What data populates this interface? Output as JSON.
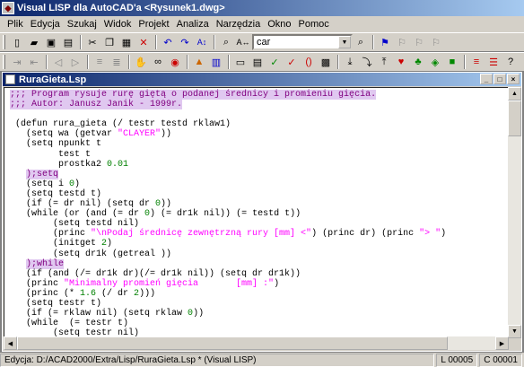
{
  "window": {
    "title": "Visual LISP dla AutoCAD'a <Rysunek1.dwg>"
  },
  "menu": [
    "Plik",
    "Edycja",
    "Szukaj",
    "Widok",
    "Projekt",
    "Analiza",
    "Narzędzia",
    "Okno",
    "Pomoc"
  ],
  "toolbar": {
    "search_value": "car"
  },
  "document": {
    "title": "RuraGieta.Lsp",
    "lines": [
      [
        {
          "t": ";;; Program rysuje rurę giętą o podanej średnicy i promieniu gięcia.",
          "c": "cmt"
        }
      ],
      [
        {
          "t": ";;; Autor: Janusz Janik - 1999r.",
          "c": "cmt"
        }
      ],
      [
        {
          "t": ""
        }
      ],
      [
        {
          "t": " (defun rura_gieta (/ testr testd rklaw1)"
        }
      ],
      [
        {
          "t": "   (setq wa (getvar "
        },
        {
          "t": "\"CLAYER\"",
          "c": "str"
        },
        {
          "t": "))"
        }
      ],
      [
        {
          "t": "   (setq npunkt t"
        }
      ],
      [
        {
          "t": "         test t"
        }
      ],
      [
        {
          "t": "         prostka2 "
        },
        {
          "t": "0.01",
          "c": "num"
        }
      ],
      [
        {
          "t": "   "
        },
        {
          "t": ");setq",
          "c": "cmt"
        }
      ],
      [
        {
          "t": "   (setq i "
        },
        {
          "t": "0",
          "c": "num"
        },
        {
          "t": ")"
        }
      ],
      [
        {
          "t": "   (setq testd t)"
        }
      ],
      [
        {
          "t": "   (if (= dr nil) (setq dr "
        },
        {
          "t": "0",
          "c": "num"
        },
        {
          "t": "))"
        }
      ],
      [
        {
          "t": "   (while (or (and (= dr "
        },
        {
          "t": "0",
          "c": "num"
        },
        {
          "t": ") (= dr1k nil)) (= testd t))"
        }
      ],
      [
        {
          "t": "        (setq testd nil)"
        }
      ],
      [
        {
          "t": "        (princ "
        },
        {
          "t": "\"\\nPodaj średnicę zewnętrzną rury [mm] <\"",
          "c": "str"
        },
        {
          "t": ") (princ dr) (princ "
        },
        {
          "t": "\"> \"",
          "c": "str"
        },
        {
          "t": ")"
        }
      ],
      [
        {
          "t": "        (initget "
        },
        {
          "t": "2",
          "c": "num"
        },
        {
          "t": ")"
        }
      ],
      [
        {
          "t": "        (setq dr1k (getreal ))"
        }
      ],
      [
        {
          "t": "   "
        },
        {
          "t": ");while",
          "c": "cmt"
        }
      ],
      [
        {
          "t": "   (if (and (/= dr1k dr)(/= dr1k nil)) (setq dr dr1k))"
        }
      ],
      [
        {
          "t": "   (princ "
        },
        {
          "t": "\"Minimalny promień gięcia       [mm] :\"",
          "c": "str"
        },
        {
          "t": ")"
        }
      ],
      [
        {
          "t": "   (princ (* "
        },
        {
          "t": "1.6",
          "c": "num"
        },
        {
          "t": " (/ dr "
        },
        {
          "t": "2",
          "c": "num"
        },
        {
          "t": ")))"
        }
      ],
      [
        {
          "t": "   (setq testr t)"
        }
      ],
      [
        {
          "t": "   (if (= rklaw nil) (setq rklaw "
        },
        {
          "t": "0",
          "c": "num"
        },
        {
          "t": "))"
        }
      ],
      [
        {
          "t": "   (while  (= testr t)"
        }
      ],
      [
        {
          "t": "        (setq testr nil)"
        }
      ]
    ]
  },
  "status": {
    "text": "Edycja:  D:/ACAD2000/Extra/Lisp/RuraGieta.Lsp *  (Visual LISP)",
    "line": "L 00005",
    "col": "C 00001"
  },
  "colors": {
    "comment_bg": "#e0c8f0",
    "comment_fg": "#800080",
    "string": "#ff00ff",
    "number": "#008000",
    "title_bar": "#0a246a"
  },
  "icons": {
    "toolbar1": [
      "new-file-icon",
      "open-folder-icon",
      "save-icon",
      "print-icon",
      "sep",
      "cut-icon",
      "copy-icon",
      "paste-icon",
      "delete-icon",
      "sep",
      "undo-icon",
      "redo-icon",
      "complete-word-icon",
      "sep",
      "find-icon",
      "replace-icon",
      "combo",
      "search-toolbox-icon",
      "sep",
      "toggle-bookmark-icon",
      "next-bookmark-icon",
      "prev-bookmark-icon",
      "clear-bookmarks-icon"
    ],
    "toolbar2": [
      "indent-icon",
      "outdent-icon",
      "sep",
      "previous-icon",
      "next-icon",
      "sep",
      "comment-icon",
      "uncomment-icon",
      "sep",
      "pan-icon",
      "glasses-icon",
      "inspect-icon",
      "sep",
      "load-window-icon",
      "load-selection-icon",
      "sep",
      "format-window-icon",
      "format-selection-icon",
      "check-window-icon",
      "check-selection-icon",
      "parentheses-match-icon",
      "symbol-service-icon",
      "sep",
      "step-into-icon",
      "step-over-icon",
      "step-out-icon",
      "continue-icon",
      "quit-icon",
      "reset-icon",
      "toggle-breakpoint-icon",
      "sep",
      "watch-icon",
      "trace-icon",
      "help-icon"
    ]
  }
}
